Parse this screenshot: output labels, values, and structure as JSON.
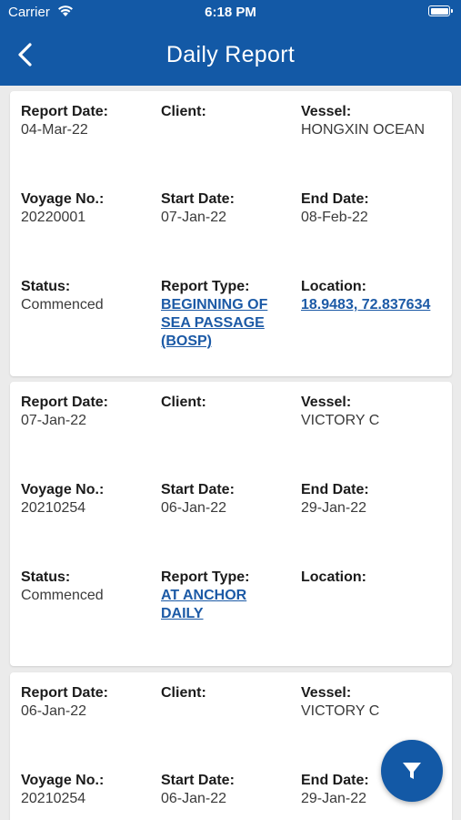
{
  "status_bar": {
    "carrier": "Carrier",
    "time": "6:18 PM"
  },
  "header": {
    "title": "Daily Report",
    "back_icon": "chevron-left-icon",
    "background": "#1359a6"
  },
  "labels": {
    "report_date": "Report Date:",
    "client": "Client:",
    "vessel": "Vessel:",
    "voyage_no": "Voyage No.:",
    "start_date": "Start Date:",
    "end_date": "End Date:",
    "status": "Status:",
    "report_type": "Report Type:",
    "location": "Location:"
  },
  "reports": [
    {
      "report_date": "04-Mar-22",
      "client": "",
      "vessel": "HONGXIN OCEAN",
      "voyage_no": "20220001",
      "start_date": "07-Jan-22",
      "end_date": "08-Feb-22",
      "status": "Commenced",
      "report_type": "BEGINNING OF SEA PASSAGE (BOSP)",
      "location": "18.9483, 72.837634"
    },
    {
      "report_date": "07-Jan-22",
      "client": "",
      "vessel": "VICTORY C",
      "voyage_no": "20210254",
      "start_date": "06-Jan-22",
      "end_date": "29-Jan-22",
      "status": "Commenced",
      "report_type": "AT ANCHOR DAILY",
      "location": ""
    },
    {
      "report_date": "06-Jan-22",
      "client": "",
      "vessel": "VICTORY C",
      "voyage_no": "20210254",
      "start_date": "06-Jan-22",
      "end_date": "29-Jan-22",
      "status": "",
      "report_type": "",
      "location": ""
    }
  ],
  "filter_button": {
    "icon": "filter-icon"
  }
}
